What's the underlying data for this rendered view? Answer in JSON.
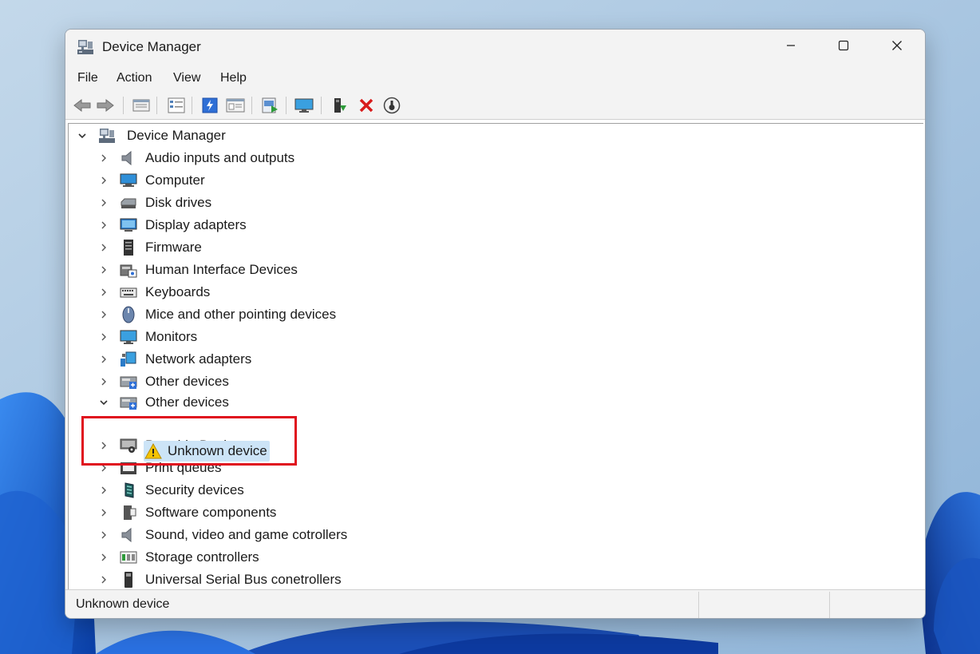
{
  "window": {
    "title": "Device Manager",
    "controls": {
      "minimize": "minimize",
      "maximize": "maximize",
      "close": "close"
    }
  },
  "menu": [
    "File",
    "Action",
    "View",
    "Help"
  ],
  "toolbar_icons": [
    "back-arrow-icon",
    "forward-arrow-icon",
    "properties-icon",
    "details-view-icon",
    "update-driver-icon",
    "help-view-icon",
    "scan-hardware-icon",
    "monitor-icon",
    "enable-device-icon",
    "uninstall-device-icon",
    "download-icon"
  ],
  "tree": {
    "root": "Device Manager",
    "categories": [
      {
        "label": "Audio inputs and outputs",
        "icon": "speaker-icon"
      },
      {
        "label": "Computer",
        "icon": "computer-icon"
      },
      {
        "label": "Disk drives",
        "icon": "disk-drive-icon"
      },
      {
        "label": "Display adapters",
        "icon": "display-adapter-icon"
      },
      {
        "label": "Firmware",
        "icon": "firmware-icon"
      },
      {
        "label": "Human Interface Devices",
        "icon": "hid-icon"
      },
      {
        "label": "Keyboards",
        "icon": "keyboard-icon"
      },
      {
        "label": "Mice and other pointing devices",
        "icon": "mouse-icon"
      },
      {
        "label": "Monitors",
        "icon": "monitor-icon"
      },
      {
        "label": "Network adapters",
        "icon": "network-adapter-icon"
      },
      {
        "label": "Other devices",
        "icon": "other-devices-icon"
      },
      {
        "label": "Other devices",
        "icon": "other-devices-icon",
        "expanded": true
      },
      {
        "label": "Portable Devices",
        "icon": "portable-device-icon"
      },
      {
        "label": "Print queues",
        "icon": "printer-icon"
      },
      {
        "label": "Security devices",
        "icon": "security-device-icon"
      },
      {
        "label": "Software components",
        "icon": "software-component-icon"
      },
      {
        "label": "Sound, video and game cotrollers",
        "icon": "speaker-icon"
      },
      {
        "label": "Storage controllers",
        "icon": "storage-controller-icon"
      },
      {
        "label": "Universal Serial Bus conetrollers",
        "icon": "usb-icon"
      }
    ],
    "child": {
      "label": "Unknown device",
      "icon": "warning-icon",
      "selected": true
    }
  },
  "status": {
    "text": "Unknown device"
  },
  "colors": {
    "highlight_box": "#e0101e",
    "selection": "#cce4f7",
    "warning": "#f5c400"
  }
}
